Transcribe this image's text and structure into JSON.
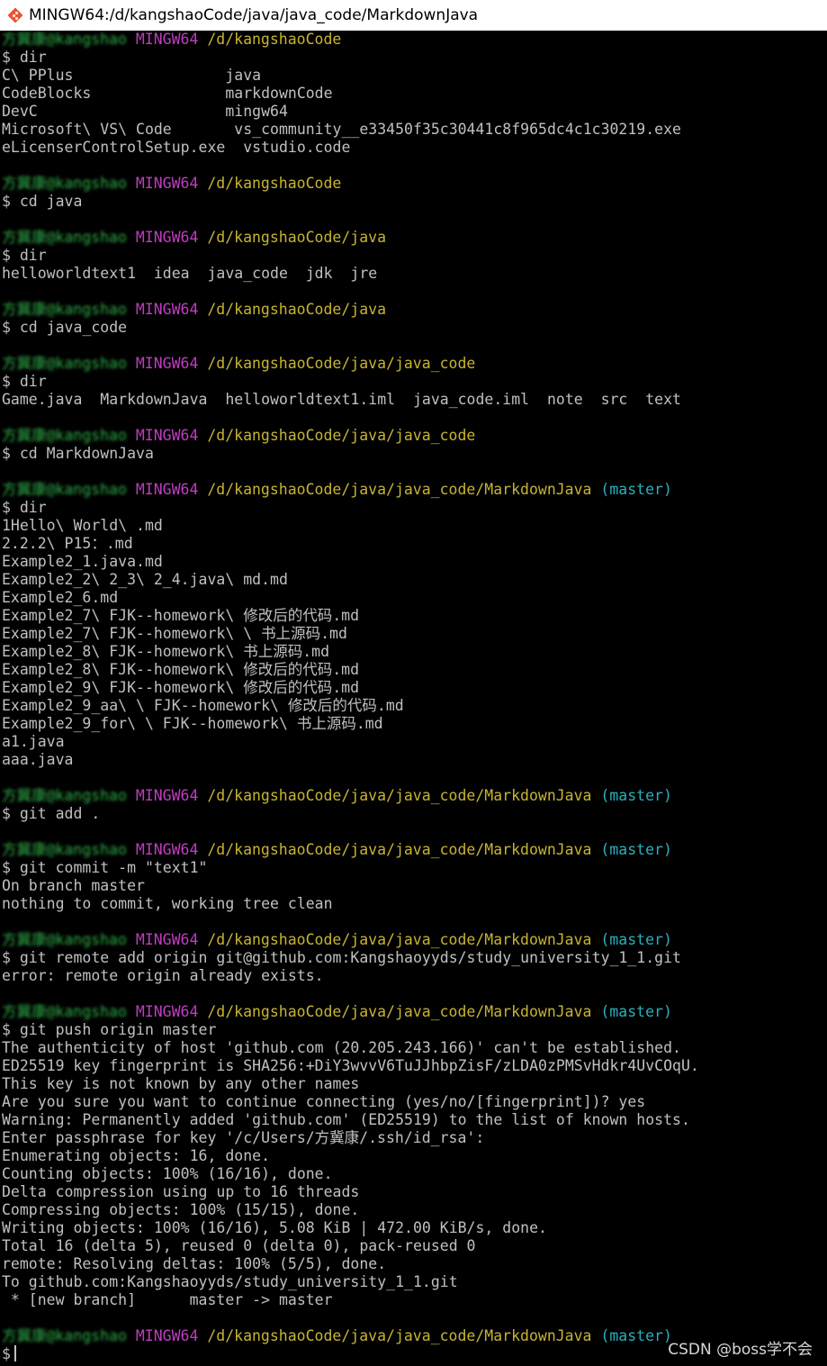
{
  "window": {
    "title": "MINGW64:/d/kangshaoCode/java/java_code/MarkdownJava",
    "icon": "git-bash-icon"
  },
  "colors": {
    "background": "#000000",
    "text": "#c0c0c0",
    "user": "#2fae48",
    "host": "#c03cc0",
    "path": "#c8b432",
    "branch": "#2ab0c0"
  },
  "watermark": "CSDN @boss学不会",
  "lines": [
    {
      "type": "prompt",
      "user": "方冀康@kangshao",
      "host": "MINGW64",
      "path": "/d/kangshaoCode",
      "branch": ""
    },
    {
      "type": "output",
      "text": "$ dir"
    },
    {
      "type": "output",
      "text": "C\\ PPlus                 java"
    },
    {
      "type": "output",
      "text": "CodeBlocks               markdownCode"
    },
    {
      "type": "output",
      "text": "DevC                     mingw64"
    },
    {
      "type": "output",
      "text": "Microsoft\\ VS\\ Code       vs_community__e33450f35c30441c8f965dc4c1c30219.exe"
    },
    {
      "type": "output",
      "text": "eLicenserControlSetup.exe  vstudio.code"
    },
    {
      "type": "blank"
    },
    {
      "type": "prompt",
      "user": "方冀康@kangshao",
      "host": "MINGW64",
      "path": "/d/kangshaoCode",
      "branch": ""
    },
    {
      "type": "output",
      "text": "$ cd java"
    },
    {
      "type": "blank"
    },
    {
      "type": "prompt",
      "user": "方冀康@kangshao",
      "host": "MINGW64",
      "path": "/d/kangshaoCode/java",
      "branch": ""
    },
    {
      "type": "output",
      "text": "$ dir"
    },
    {
      "type": "output",
      "text": "helloworldtext1  idea  java_code  jdk  jre"
    },
    {
      "type": "blank"
    },
    {
      "type": "prompt",
      "user": "方冀康@kangshao",
      "host": "MINGW64",
      "path": "/d/kangshaoCode/java",
      "branch": ""
    },
    {
      "type": "output",
      "text": "$ cd java_code"
    },
    {
      "type": "blank"
    },
    {
      "type": "prompt",
      "user": "方冀康@kangshao",
      "host": "MINGW64",
      "path": "/d/kangshaoCode/java/java_code",
      "branch": ""
    },
    {
      "type": "output",
      "text": "$ dir"
    },
    {
      "type": "output",
      "text": "Game.java  MarkdownJava  helloworldtext1.iml  java_code.iml  note  src  text"
    },
    {
      "type": "blank"
    },
    {
      "type": "prompt",
      "user": "方冀康@kangshao",
      "host": "MINGW64",
      "path": "/d/kangshaoCode/java/java_code",
      "branch": ""
    },
    {
      "type": "output",
      "text": "$ cd MarkdownJava"
    },
    {
      "type": "blank"
    },
    {
      "type": "prompt",
      "user": "方冀康@kangshao",
      "host": "MINGW64",
      "path": "/d/kangshaoCode/java/java_code/MarkdownJava",
      "branch": "(master)"
    },
    {
      "type": "output",
      "text": "$ dir"
    },
    {
      "type": "output",
      "text": "1Hello\\ World\\ .md"
    },
    {
      "type": "output",
      "text": "2.2.2\\ P15：.md"
    },
    {
      "type": "output",
      "text": "Example2_1.java.md"
    },
    {
      "type": "output",
      "text": "Example2_2\\ 2_3\\ 2_4.java\\ md.md"
    },
    {
      "type": "output",
      "text": "Example2_6.md"
    },
    {
      "type": "output",
      "text": "Example2_7\\ FJK--homework\\ 修改后的代码.md"
    },
    {
      "type": "output",
      "text": "Example2_7\\ FJK--homework\\ \\ 书上源码.md"
    },
    {
      "type": "output",
      "text": "Example2_8\\ FJK--homework\\ 书上源码.md"
    },
    {
      "type": "output",
      "text": "Example2_8\\ FJK--homework\\ 修改后的代码.md"
    },
    {
      "type": "output",
      "text": "Example2_9\\ FJK--homework\\ 修改后的代码.md"
    },
    {
      "type": "output",
      "text": "Example2_9_aa\\ \\ FJK--homework\\ 修改后的代码.md"
    },
    {
      "type": "output",
      "text": "Example2_9_for\\ \\ FJK--homework\\ 书上源码.md"
    },
    {
      "type": "output",
      "text": "a1.java"
    },
    {
      "type": "output",
      "text": "aaa.java"
    },
    {
      "type": "blank"
    },
    {
      "type": "prompt",
      "user": "方冀康@kangshao",
      "host": "MINGW64",
      "path": "/d/kangshaoCode/java/java_code/MarkdownJava",
      "branch": "(master)"
    },
    {
      "type": "output",
      "text": "$ git add ."
    },
    {
      "type": "blank"
    },
    {
      "type": "prompt",
      "user": "方冀康@kangshao",
      "host": "MINGW64",
      "path": "/d/kangshaoCode/java/java_code/MarkdownJava",
      "branch": "(master)"
    },
    {
      "type": "output",
      "text": "$ git commit -m \"text1\""
    },
    {
      "type": "output",
      "text": "On branch master"
    },
    {
      "type": "output",
      "text": "nothing to commit, working tree clean"
    },
    {
      "type": "blank"
    },
    {
      "type": "prompt",
      "user": "方冀康@kangshao",
      "host": "MINGW64",
      "path": "/d/kangshaoCode/java/java_code/MarkdownJava",
      "branch": "(master)"
    },
    {
      "type": "output",
      "text": "$ git remote add origin git@github.com:Kangshaoyyds/study_university_1_1.git"
    },
    {
      "type": "output",
      "text": "error: remote origin already exists."
    },
    {
      "type": "blank"
    },
    {
      "type": "prompt",
      "user": "方冀康@kangshao",
      "host": "MINGW64",
      "path": "/d/kangshaoCode/java/java_code/MarkdownJava",
      "branch": "(master)"
    },
    {
      "type": "output",
      "text": "$ git push origin master"
    },
    {
      "type": "output",
      "text": "The authenticity of host 'github.com (20.205.243.166)' can't be established."
    },
    {
      "type": "output",
      "text": "ED25519 key fingerprint is SHA256:+DiY3wvvV6TuJJhbpZisF/zLDA0zPMSvHdkr4UvCOqU."
    },
    {
      "type": "output",
      "text": "This key is not known by any other names"
    },
    {
      "type": "output",
      "text": "Are you sure you want to continue connecting (yes/no/[fingerprint])? yes"
    },
    {
      "type": "output",
      "text": "Warning: Permanently added 'github.com' (ED25519) to the list of known hosts."
    },
    {
      "type": "output",
      "text": "Enter passphrase for key '/c/Users/方冀康/.ssh/id_rsa':"
    },
    {
      "type": "output",
      "text": "Enumerating objects: 16, done."
    },
    {
      "type": "output",
      "text": "Counting objects: 100% (16/16), done."
    },
    {
      "type": "output",
      "text": "Delta compression using up to 16 threads"
    },
    {
      "type": "output",
      "text": "Compressing objects: 100% (15/15), done."
    },
    {
      "type": "output",
      "text": "Writing objects: 100% (16/16), 5.08 KiB | 472.00 KiB/s, done."
    },
    {
      "type": "output",
      "text": "Total 16 (delta 5), reused 0 (delta 0), pack-reused 0"
    },
    {
      "type": "output",
      "text": "remote: Resolving deltas: 100% (5/5), done."
    },
    {
      "type": "output",
      "text": "To github.com:Kangshaoyyds/study_university_1_1.git"
    },
    {
      "type": "output",
      "text": " * [new branch]      master -> master"
    },
    {
      "type": "blank"
    },
    {
      "type": "prompt",
      "user": "方冀康@kangshao",
      "host": "MINGW64",
      "path": "/d/kangshaoCode/java/java_code/MarkdownJava",
      "branch": "(master)"
    },
    {
      "type": "input",
      "text": "$"
    }
  ]
}
